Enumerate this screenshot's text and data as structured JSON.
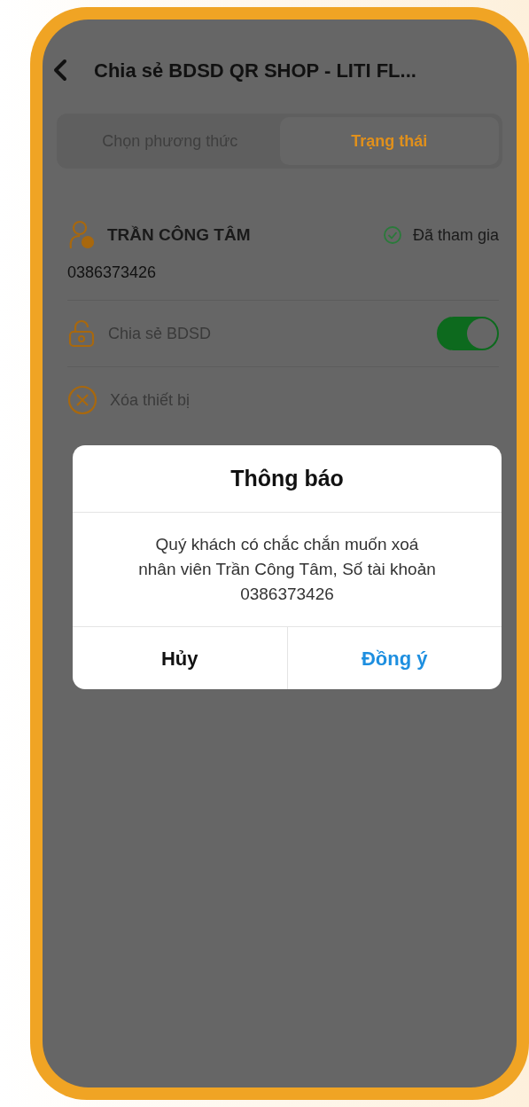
{
  "header": {
    "title": "Chia sẻ BDSD QR SHOP - LITI FL..."
  },
  "tabs": [
    {
      "label": "Chọn phương thức",
      "selected": false
    },
    {
      "label": "Trạng thái",
      "selected": true
    }
  ],
  "member": {
    "name": "TRẦN CÔNG TÂM",
    "status": "Đã tham gia",
    "phone": "0386373426"
  },
  "options": [
    {
      "kind": "toggle",
      "label": "Chia sẻ BDSD",
      "on": true
    },
    {
      "kind": "action",
      "label": "Xóa thiết bị"
    }
  ],
  "dialog": {
    "title": "Thông báo",
    "message": "Quý khách có chắc chắn muốn xoá\nnhân viên Trần Công Tâm, Số tài khoản\n0386373426",
    "buttons": [
      {
        "kind": "cancel",
        "label": "Hủy"
      },
      {
        "kind": "confirm",
        "label": "Đồng ý"
      }
    ]
  }
}
